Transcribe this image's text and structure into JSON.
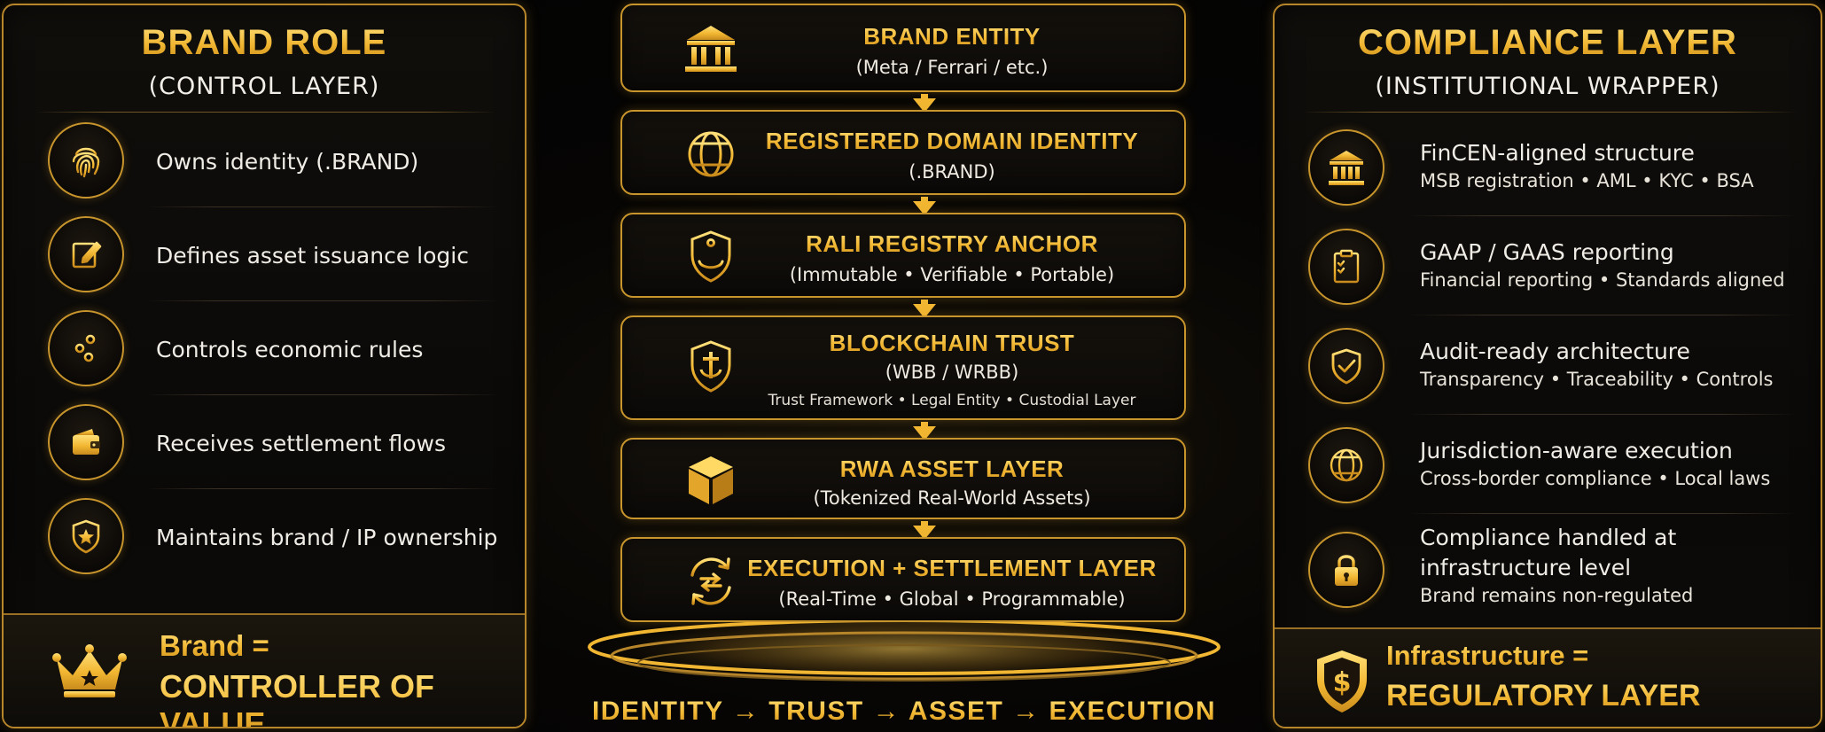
{
  "left_panel": {
    "title": "BRAND ROLE",
    "subtitle": "(CONTROL LAYER)",
    "items": [
      {
        "label": "Owns identity (.BRAND)",
        "icon": "fingerprint-icon"
      },
      {
        "label": "Defines asset issuance logic",
        "icon": "edit-document-icon"
      },
      {
        "label": "Controls economic rules",
        "icon": "sliders-icon"
      },
      {
        "label": "Receives settlement flows",
        "icon": "wallet-icon"
      },
      {
        "label": "Maintains brand / IP ownership",
        "icon": "shield-star-icon"
      }
    ],
    "footer": {
      "line1": "Brand =",
      "line2": "CONTROLLER OF VALUE",
      "icon": "crown-icon"
    }
  },
  "center_stack": {
    "layers": [
      {
        "title": "BRAND ENTITY",
        "subtitle": "(Meta / Ferrari / etc.)",
        "icon": "institution-icon"
      },
      {
        "title": "REGISTERED DOMAIN IDENTITY",
        "subtitle": "(.BRAND)",
        "icon": "globe-icon"
      },
      {
        "title": "RALI REGISTRY ANCHOR",
        "subtitle": "(Immutable • Verifiable • Portable)",
        "icon": "anchor-shield-icon"
      },
      {
        "title": "BLOCKCHAIN TRUST",
        "subtitle": "(WBB / WRBB)",
        "subtitle2": "Trust Framework • Legal Entity • Custodial Layer",
        "icon": "shield-anchor-icon"
      },
      {
        "title": "RWA ASSET LAYER",
        "subtitle": "(Tokenized Real-World Assets)",
        "icon": "cube-icon"
      },
      {
        "title": "EXECUTION + SETTLEMENT LAYER",
        "subtitle": "(Real-Time • Global • Programmable)",
        "icon": "exchange-cycle-icon"
      }
    ],
    "flow": "IDENTITY → TRUST → ASSET → EXECUTION"
  },
  "right_panel": {
    "title": "COMPLIANCE LAYER",
    "subtitle": "(INSTITUTIONAL WRAPPER)",
    "items": [
      {
        "label": "FinCEN-aligned structure",
        "detail": "MSB registration • AML • KYC • BSA",
        "icon": "institution-icon"
      },
      {
        "label": "GAAP / GAAS reporting",
        "detail": "Financial reporting • Standards aligned",
        "icon": "clipboard-check-icon"
      },
      {
        "label": "Audit-ready architecture",
        "detail": "Transparency • Traceability • Controls",
        "icon": "shield-check-icon"
      },
      {
        "label": "Jurisdiction-aware execution",
        "detail": "Cross-border compliance • Local laws",
        "icon": "globe-icon"
      },
      {
        "label": "Compliance handled at",
        "label2": "infrastructure level",
        "detail": "Brand remains non-regulated",
        "icon": "lock-icon"
      }
    ],
    "footer": {
      "line1": "Infrastructure =",
      "line2": "REGULATORY LAYER",
      "icon": "shield-dollar-icon"
    }
  },
  "colors": {
    "gold": "#f2b732",
    "gold_light": "#ffe07a",
    "background": "#030303",
    "text": "#f0ede6"
  }
}
